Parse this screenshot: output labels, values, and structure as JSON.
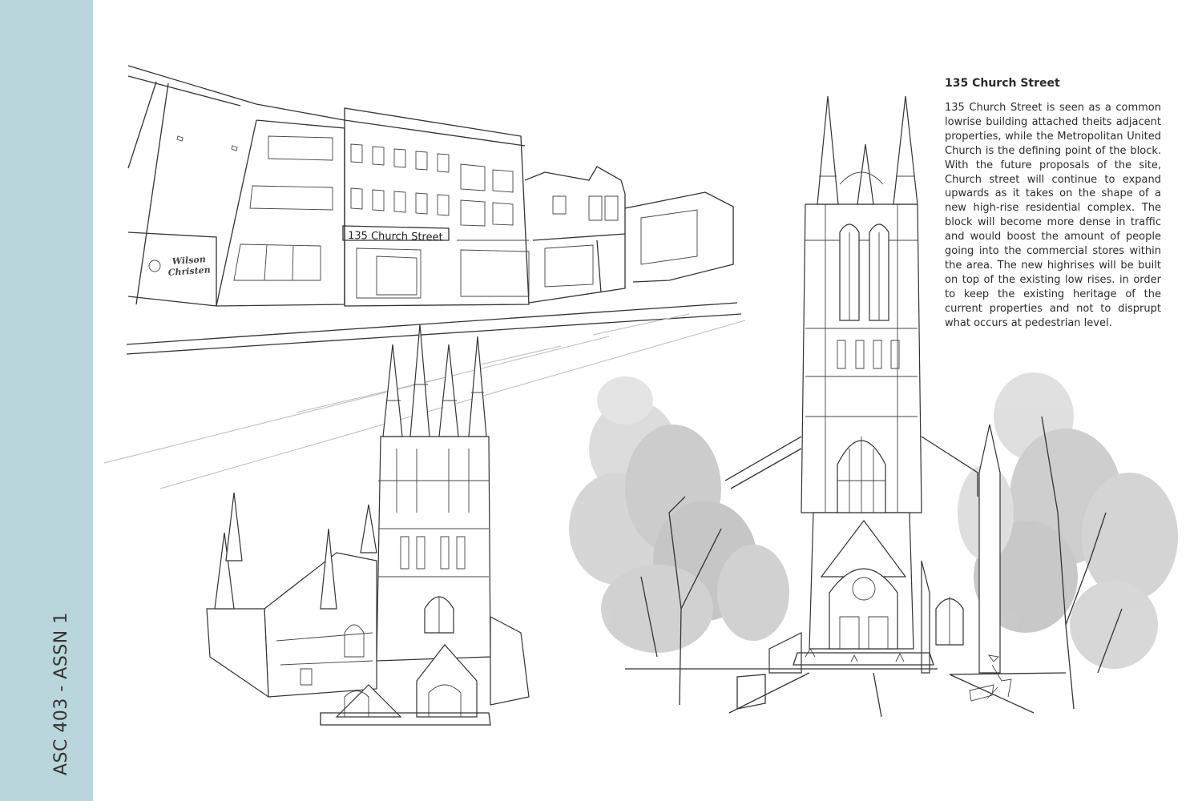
{
  "sidebar": {
    "label": "ASC 403 - ASSN 1",
    "color": "#b9d6dc"
  },
  "text_block": {
    "title": "135 Church Street",
    "body": "135 Church Street is seen as a common lowrise building attached theits adjacent properties, while the Metropolitan United Church is the defining point of the block. With the future proposals of the site, Church street will continue to expand upwards as it takes on the shape of a new high-rise residential complex. The block will become more dense in traffic and would boost the amount of people going into the commercial stores within the area. The new highrises will be built on top of the existing low rises. in order to keep the existing heritage of the current properties and not to disprupt what occurs at pedestrian level."
  },
  "sketches": {
    "street": {
      "sign_text": "135 Church Street",
      "storefront_text": "Wilson Christen"
    },
    "church_perspective": {},
    "church_elevation": {}
  }
}
